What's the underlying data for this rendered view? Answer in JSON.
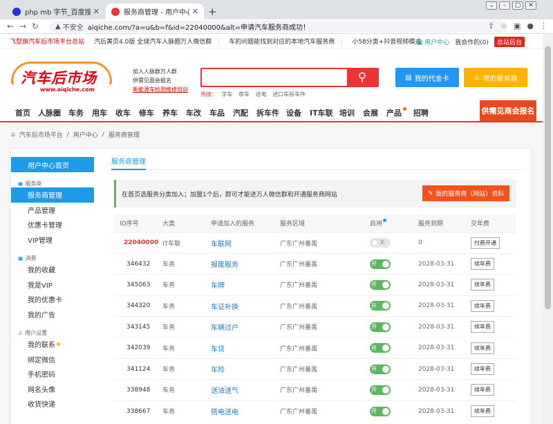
{
  "browser": {
    "tabs": [
      {
        "title": "php mb 字节_百度搜索"
      },
      {
        "title": "服务商管理 - 用户中心 - 汽车后市"
      }
    ],
    "security": "不安全",
    "url": "aiqiche.com/?a=u&b=f&id=22040000&alt=申请汽车服务商成功！"
  },
  "topstrip": {
    "announcements": [
      "飞型旗汽车后市场平台总站",
      "汽后黄页4.0版 全球汽车人脉圈万人微信群",
      "车的问题能找到对应的本地汽车服务商",
      "小58分类+抖音视频模式"
    ],
    "user_center": "用户中心",
    "my_coop": "我合作的(0)",
    "backend": "总站后台"
  },
  "header": {
    "logo_text": "汽车后市场",
    "logo_url": "www.aiqiche.com",
    "slogan": [
      "加入人脉群万人群",
      "供需见面会报名",
      "新能源车检测维修培训"
    ],
    "hot_label": "热搜：",
    "hot_words": [
      "学车",
      "审车",
      "送电",
      "进口车拆车件"
    ],
    "btn_card": "我的代金卡",
    "btn_provider": "我的服务商"
  },
  "nav": {
    "items": [
      "首页",
      "人脉圈",
      "车务",
      "用车",
      "收车",
      "修车",
      "养车",
      "车改",
      "车品",
      "汽配",
      "拆车件",
      "设备",
      "IT车联",
      "培训",
      "会展",
      "产品",
      "招聘"
    ],
    "special": "供需见商会报名"
  },
  "breadcrumb": [
    "汽车后市场平台",
    "用户中心",
    "服务商管理"
  ],
  "sidebar": {
    "home": "用户中心首页",
    "groups": [
      {
        "title": "服务商",
        "items": [
          "服务商管理",
          "产品管理",
          "优惠卡管理",
          "VIP管理"
        ]
      },
      {
        "title": "消费",
        "items": [
          "我的收藏",
          "我是VIP",
          "我的优惠卡",
          "我的广告"
        ]
      },
      {
        "title": "用户设置",
        "items": [
          "我的联系",
          "绑定微信",
          "手机密码",
          "网名头像",
          "收货快递"
        ]
      }
    ]
  },
  "main": {
    "tab": "服务商管理",
    "notice": "在首页选服务分类加入；加盟1个后，即可才能进万人微信群和开通服务商网站",
    "notice_btn": "我的服务商（网站）资料",
    "table": {
      "headers": [
        "ID序号",
        "大类",
        "申请加入的服务",
        "服务区域",
        "启用",
        "服务到期",
        "交年费"
      ],
      "rows": [
        {
          "id": "22040000",
          "cat": "IT车联",
          "svc": "车联网",
          "area": "广东广州番禺",
          "on": false,
          "toggle": "关",
          "expire": "0",
          "fee": "付费开通"
        },
        {
          "id": "346432",
          "cat": "车务",
          "svc": "报废服务",
          "area": "广东广州番禺",
          "on": true,
          "toggle": "开",
          "expire": "2028-03-31",
          "fee": "续年费"
        },
        {
          "id": "345063",
          "cat": "车务",
          "svc": "车牌",
          "area": "广东广州番禺",
          "on": true,
          "toggle": "开",
          "expire": "2028-03-31",
          "fee": "续年费"
        },
        {
          "id": "344320",
          "cat": "车务",
          "svc": "车证补换",
          "area": "广东广州番禺",
          "on": true,
          "toggle": "开",
          "expire": "2028-03-31",
          "fee": "续年费"
        },
        {
          "id": "343145",
          "cat": "车务",
          "svc": "车辆过户",
          "area": "广东广州番禺",
          "on": true,
          "toggle": "开",
          "expire": "2028-03-31",
          "fee": "续年费"
        },
        {
          "id": "342039",
          "cat": "车务",
          "svc": "车贷",
          "area": "广东广州番禺",
          "on": true,
          "toggle": "开",
          "expire": "2028-03-31",
          "fee": "续年费"
        },
        {
          "id": "341124",
          "cat": "车务",
          "svc": "车险",
          "area": "广东广州番禺",
          "on": true,
          "toggle": "开",
          "expire": "2028-03-31",
          "fee": "续年费"
        },
        {
          "id": "338948",
          "cat": "车务",
          "svc": "送油送气",
          "area": "广东广州番禺",
          "on": true,
          "toggle": "开",
          "expire": "2028-03-31",
          "fee": "续年费"
        },
        {
          "id": "338667",
          "cat": "车务",
          "svc": "搭电送电",
          "area": "广东广州番禺",
          "on": true,
          "toggle": "开",
          "expire": "2028-03-31",
          "fee": "续年费"
        }
      ]
    }
  }
}
